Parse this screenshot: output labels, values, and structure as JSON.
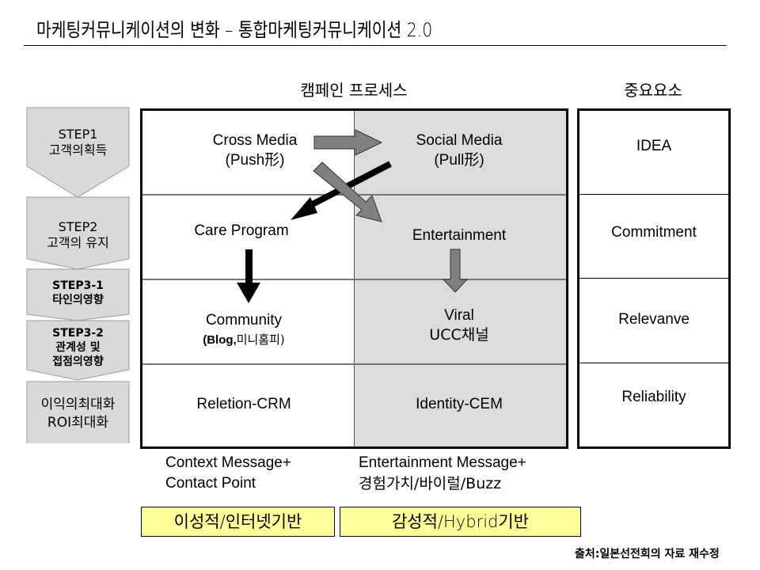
{
  "title": "마케팅커뮤니케이션의 변화 – 통합마케팅커뮤니케이션 2.0",
  "sections": {
    "process_header": "캠페인 프로세스",
    "key_header": "중요요소"
  },
  "steps": [
    {
      "line1": "STEP1",
      "line2": "고객의획득",
      "line3": ""
    },
    {
      "line1": "STEP2",
      "line2": "고객의 유지",
      "line3": ""
    },
    {
      "line1": "STEP3-1",
      "line2": "타인의영향",
      "line3": ""
    },
    {
      "line1": "STEP3-2",
      "line2": "관계성 및",
      "line3": "접점의영향"
    },
    {
      "line1": "이익의최대화",
      "line2": "ROI최대화",
      "line3": ""
    }
  ],
  "grid": {
    "rows": [
      {
        "left": {
          "line1": "Cross Media",
          "line2": "(Push形)"
        },
        "right": {
          "line1": "Social Media",
          "line2": "(Pull形)"
        }
      },
      {
        "left": {
          "line1": "Care Program",
          "line2": ""
        },
        "right": {
          "line1": "Entertainment",
          "line2": ""
        }
      },
      {
        "left": {
          "line1": "Community",
          "line2_a": "(Blog,",
          "line2_b": "미니홈피",
          "line2_c": ")"
        },
        "right": {
          "line1": "Viral",
          "line2": "UCC채널"
        }
      },
      {
        "left": {
          "line1": "Reletion-CRM"
        },
        "right": {
          "line1": "Identity-CEM"
        }
      }
    ],
    "arrows": [
      {
        "from": "Cross Media",
        "to": "Social Media",
        "style": "gray-block"
      },
      {
        "from": "Cross Media",
        "to": "Entertainment",
        "style": "gray-block"
      },
      {
        "from": "Social Media",
        "to": "Care Program",
        "style": "black-line"
      },
      {
        "from": "Care Program",
        "to": "Community",
        "style": "black-line"
      },
      {
        "from": "Entertainment",
        "to": "Viral",
        "style": "gray-block"
      }
    ],
    "right_bg_color": "#dcdcdc"
  },
  "key_elements": [
    "IDEA",
    "Commitment",
    "Relevanve",
    "Reliability"
  ],
  "messages": {
    "left": {
      "line1": "Context Message+",
      "line2": "Contact Point"
    },
    "right": {
      "line1": "Entertainment Message+",
      "line2": "경험가치/바이럴/Buzz"
    }
  },
  "tags": {
    "left": "이성적/인터넷기반",
    "right": "감성적/Hybrid기반",
    "color": "#ffff99"
  },
  "source": "출처:일본선전회의 자료 재수정"
}
